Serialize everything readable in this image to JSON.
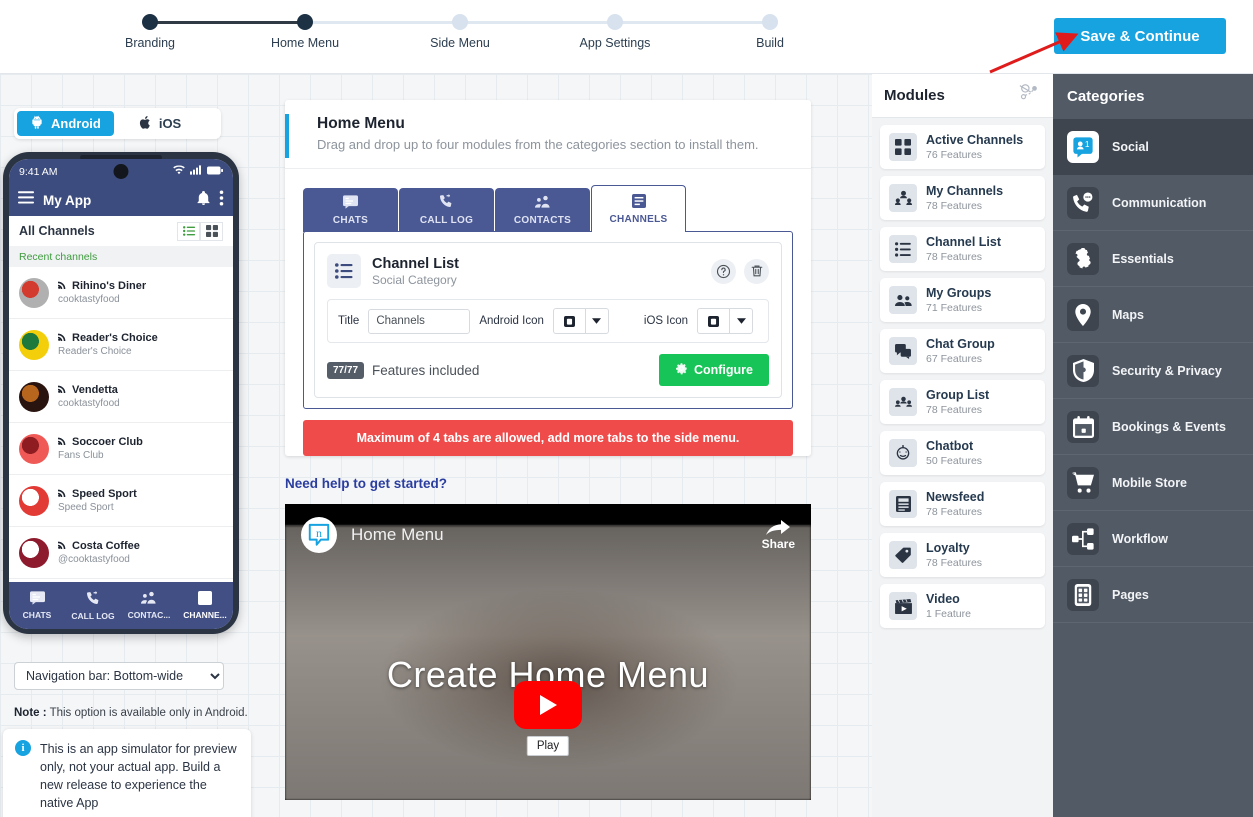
{
  "stepper": {
    "steps": [
      {
        "label": "Branding",
        "state": "done"
      },
      {
        "label": "Home Menu",
        "state": "done"
      },
      {
        "label": "Side Menu",
        "state": "todo"
      },
      {
        "label": "App Settings",
        "state": "todo"
      },
      {
        "label": "Build",
        "state": "todo"
      }
    ]
  },
  "topbar": {
    "save_label": "Save & Continue",
    "accent": "#17a2e0"
  },
  "platform": {
    "android_label": "Android",
    "ios_label": "iOS",
    "active": "Android"
  },
  "phone": {
    "status_time": "9:41 AM",
    "app_title": "My App",
    "section_title": "All Channels",
    "recent_label": "Recent channels",
    "channels": [
      {
        "name": "Rihino's Diner",
        "sub": "cooktastyfood",
        "color1": "#b0b0b0",
        "color2": "#d23b2e"
      },
      {
        "name": "Reader's Choice",
        "sub": "Reader's Choice",
        "color1": "#f2cf0a",
        "color2": "#1e7a3c"
      },
      {
        "name": "Vendetta",
        "sub": "cooktastyfood",
        "color1": "#2a1410",
        "color2": "#b8651e"
      },
      {
        "name": "Soccoer Club",
        "sub": "Fans Club",
        "color1": "#ef5a57",
        "color2": "#8e1c20"
      },
      {
        "name": "Speed Sport",
        "sub": "Speed Sport",
        "color1": "#e23b36",
        "color2": "#ffffff"
      },
      {
        "name": "Costa Coffee",
        "sub": "@cooktastyfood",
        "color1": "#8d1b2d",
        "color2": "#ffffff"
      }
    ],
    "bottom_nav": [
      {
        "label": "CHATS",
        "icon": "chat-icon",
        "active": false
      },
      {
        "label": "CALL LOG",
        "icon": "phone-icon",
        "active": false
      },
      {
        "label": "CONTAC...",
        "icon": "contacts-icon",
        "active": false
      },
      {
        "label": "CHANNE...",
        "icon": "channels-icon",
        "active": true
      }
    ]
  },
  "sim_controls": {
    "nav_select_value": "Navigation bar: Bottom-wide",
    "note_prefix": "Note :",
    "note_text": " This option is available only in Android.",
    "info_text": "This is an app simulator for preview only, not your actual app. Build a new release to experience the native App"
  },
  "main": {
    "title": "Home Menu",
    "subtitle": "Drag and drop up to four modules from the categories section to install them.",
    "tabs": [
      {
        "label": "CHATS",
        "icon": "chat-icon",
        "active": false
      },
      {
        "label": "CALL LOG",
        "icon": "phone-icon",
        "active": false
      },
      {
        "label": "CONTACTS",
        "icon": "contacts-icon",
        "active": false
      },
      {
        "label": "CHANNELS",
        "icon": "channels-icon",
        "active": true
      }
    ],
    "module": {
      "name": "Channel List",
      "category": "Social Category",
      "help_icon": "help-icon",
      "delete_icon": "trash-icon",
      "title_label": "Title",
      "title_value": "Channels",
      "android_icon_label": "Android Icon",
      "ios_icon_label": "iOS Icon",
      "features_badge": "77/77",
      "features_label": "Features included",
      "configure_label": "Configure",
      "configure_color": "#17c457"
    },
    "warning": "Maximum of 4 tabs are allowed, add more tabs to the side menu.",
    "warning_color": "#ef4b4b",
    "help_link": "Need help to get started?",
    "video": {
      "channel_title": "Home Menu",
      "share_label": "Share",
      "overlay_title": "Create Home Menu",
      "play_tooltip": "Play"
    }
  },
  "modules_panel": {
    "title": "Modules",
    "header_icon": "drag-pointer-icon",
    "items": [
      {
        "name": "Active Channels",
        "features": "76 Features",
        "icon": "grid-icon"
      },
      {
        "name": "My Channels",
        "features": "78 Features",
        "icon": "my-channels-icon"
      },
      {
        "name": "Channel List",
        "features": "78 Features",
        "icon": "list-icon"
      },
      {
        "name": "My Groups",
        "features": "71 Features",
        "icon": "group-icon"
      },
      {
        "name": "Chat Group",
        "features": "67 Features",
        "icon": "chat-bubbles-icon"
      },
      {
        "name": "Group List",
        "features": "78 Features",
        "icon": "group-list-icon"
      },
      {
        "name": "Chatbot",
        "features": "50 Features",
        "icon": "chatbot-icon"
      },
      {
        "name": "Newsfeed",
        "features": "78 Features",
        "icon": "newsfeed-icon"
      },
      {
        "name": "Loyalty",
        "features": "78 Features",
        "icon": "tag-icon"
      },
      {
        "name": "Video",
        "features": "1 Feature",
        "icon": "clapperboard-icon"
      }
    ]
  },
  "categories": {
    "title": "Categories",
    "items": [
      {
        "name": "Social",
        "icon": "social-icon",
        "active": true
      },
      {
        "name": "Communication",
        "icon": "communication-icon",
        "active": false
      },
      {
        "name": "Essentials",
        "icon": "puzzle-icon",
        "active": false
      },
      {
        "name": "Maps",
        "icon": "map-pin-icon",
        "active": false
      },
      {
        "name": "Security & Privacy",
        "icon": "shield-icon",
        "active": false
      },
      {
        "name": "Bookings & Events",
        "icon": "calendar-icon",
        "active": false
      },
      {
        "name": "Mobile Store",
        "icon": "cart-icon",
        "active": false
      },
      {
        "name": "Workflow",
        "icon": "workflow-icon",
        "active": false
      },
      {
        "name": "Pages",
        "icon": "pages-icon",
        "active": false
      }
    ]
  },
  "annotation": {
    "arrow_color": "#e01b1b"
  }
}
